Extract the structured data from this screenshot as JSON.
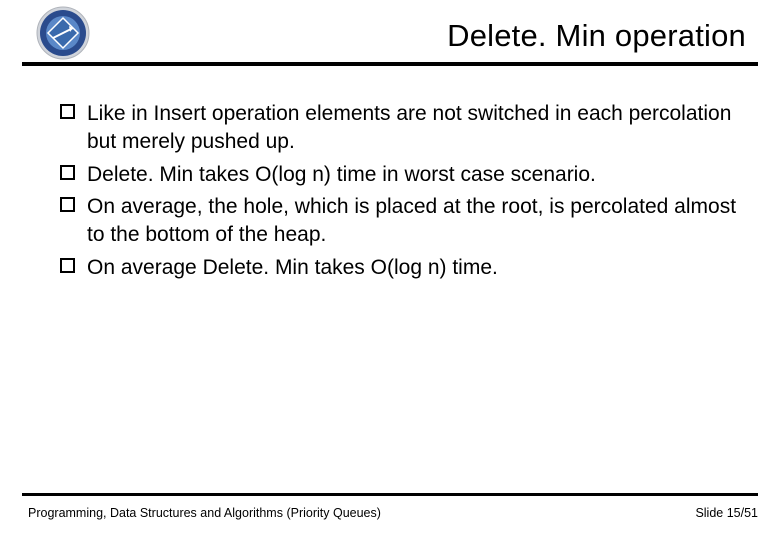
{
  "title": "Delete. Min operation",
  "bullets": [
    "Like in Insert operation elements are not switched in each percolation but merely pushed up.",
    "Delete. Min takes O(log n) time in worst case scenario.",
    "On average, the hole, which is placed at the root, is percolated almost to the bottom of the heap.",
    "On average Delete. Min takes O(log n) time."
  ],
  "footer": {
    "left": "Programming, Data Structures and Algorithms  (Priority Queues)",
    "right": "Slide 15/51"
  },
  "logo": {
    "outer": "#d0d4db",
    "ring": "#2a4b8d",
    "inner": "#5a88c8",
    "symbol": "#ffffff"
  }
}
